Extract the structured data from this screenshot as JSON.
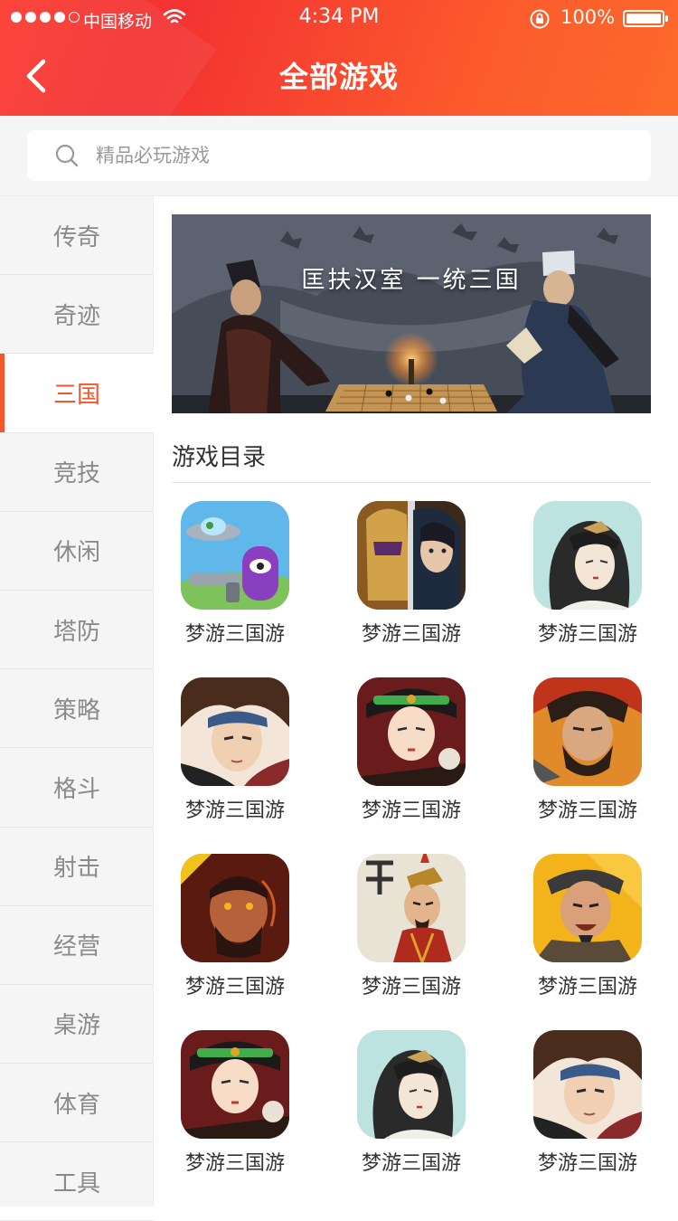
{
  "status_bar": {
    "carrier": "中国移动",
    "time": "4:34 PM",
    "battery": "100%"
  },
  "header": {
    "title": "全部游戏"
  },
  "search": {
    "placeholder": "精品必玩游戏"
  },
  "sidebar": {
    "items": [
      {
        "label": "传奇"
      },
      {
        "label": "奇迹"
      },
      {
        "label": "三国",
        "active": true
      },
      {
        "label": "竞技"
      },
      {
        "label": "休闲"
      },
      {
        "label": "塔防"
      },
      {
        "label": "策略"
      },
      {
        "label": "格斗"
      },
      {
        "label": "射击"
      },
      {
        "label": "经营"
      },
      {
        "label": "桌游"
      },
      {
        "label": "体育"
      },
      {
        "label": "工具"
      }
    ]
  },
  "banner": {
    "text": "匡扶汉室 一统三国"
  },
  "catalog": {
    "title": "游戏目录",
    "games": [
      {
        "name": "梦游三国游",
        "icon": "cartoon-ufo-icon"
      },
      {
        "name": "梦游三国游",
        "icon": "knight-warrior-icon"
      },
      {
        "name": "梦游三国游",
        "icon": "lady-sketch-icon"
      },
      {
        "name": "梦游三国游",
        "icon": "young-hero-icon"
      },
      {
        "name": "梦游三国游",
        "icon": "princess-anniversary-icon"
      },
      {
        "name": "梦游三国游",
        "icon": "bearded-general-icon"
      },
      {
        "name": "梦游三国游",
        "icon": "fierce-warrior-icon"
      },
      {
        "name": "梦游三国游",
        "icon": "han-general-icon"
      },
      {
        "name": "梦游三国游",
        "icon": "laughing-strategist-icon"
      },
      {
        "name": "梦游三国游",
        "icon": "princess-anniversary-icon"
      },
      {
        "name": "梦游三国游",
        "icon": "lady-sketch-icon"
      },
      {
        "name": "梦游三国游",
        "icon": "young-hero-icon"
      }
    ]
  },
  "colors": {
    "accent": "#f4572b",
    "header_start": "#f33232",
    "header_end": "#fd6a2b"
  }
}
